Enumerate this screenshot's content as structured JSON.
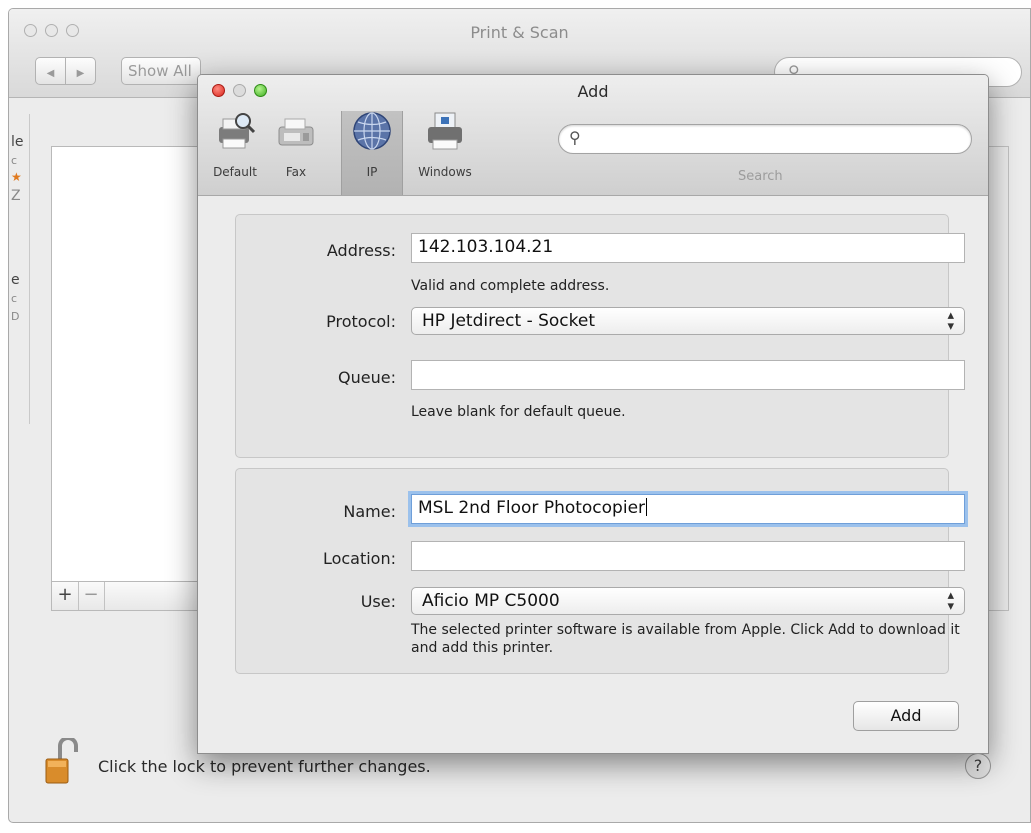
{
  "background_window": {
    "title": "Print & Scan",
    "nav_back": "◀",
    "nav_forward": "▶",
    "show_all_label": "Show All",
    "search_placeholder": "",
    "sidebar_fragments": [
      "le",
      "c",
      "★",
      "Z",
      "e",
      "c",
      "D"
    ],
    "list_add": "+",
    "list_remove": "−",
    "lock_text": "Click the lock to prevent further changes.",
    "help_label": "?"
  },
  "add_dialog": {
    "title": "Add",
    "toolbar": [
      {
        "label": "Default",
        "icon": "printer-search-icon",
        "selected": false
      },
      {
        "label": "Fax",
        "icon": "fax-icon",
        "selected": false
      },
      {
        "label": "IP",
        "icon": "globe-icon",
        "selected": true
      },
      {
        "label": "Windows",
        "icon": "windows-printer-icon",
        "selected": false
      }
    ],
    "search": {
      "placeholder": "",
      "label": "Search"
    },
    "connection": {
      "address_label": "Address:",
      "address_value": "142.103.104.21",
      "address_status": "Valid and complete address.",
      "protocol_label": "Protocol:",
      "protocol_value": "HP Jetdirect - Socket",
      "queue_label": "Queue:",
      "queue_value": "",
      "queue_hint": "Leave blank for default queue."
    },
    "printer": {
      "name_label": "Name:",
      "name_value": "MSL 2nd Floor Photocopier",
      "location_label": "Location:",
      "location_value": "",
      "use_label": "Use:",
      "use_value": "Aficio MP C5000",
      "use_note": "The selected printer software is available from Apple. Click Add to download it and add this printer."
    },
    "add_button": "Add"
  },
  "colors": {
    "close": "#e0362c",
    "zoom": "#4fbf2e",
    "focus_ring": "#9bc1ec"
  }
}
